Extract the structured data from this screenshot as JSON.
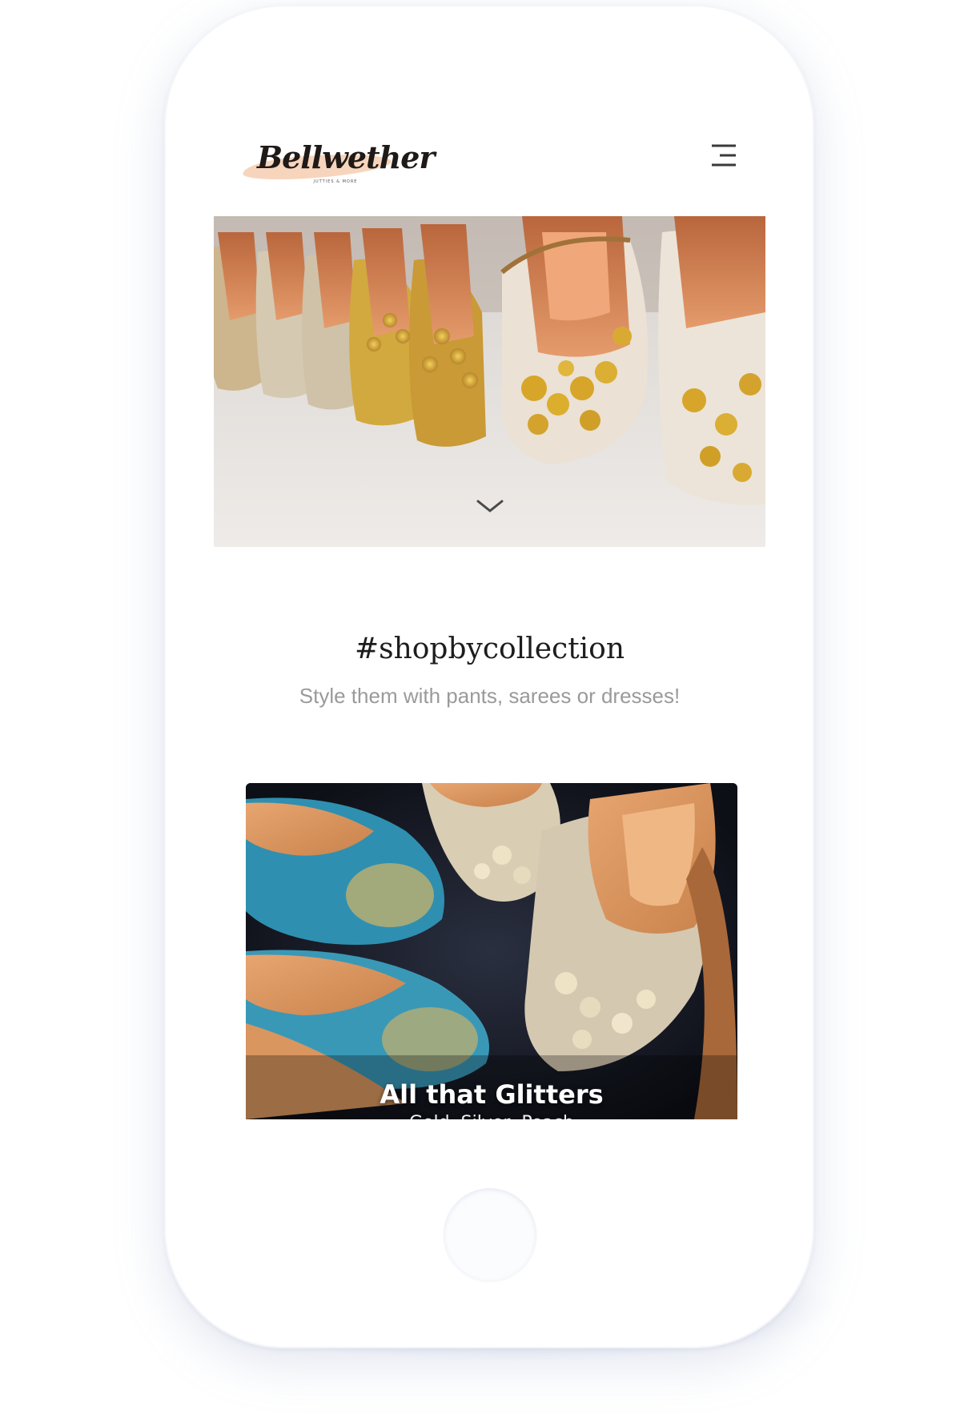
{
  "header": {
    "logo_text": "Bellwether",
    "logo_tagline": "JUTTIES & MORE"
  },
  "icons": {
    "menu": "hamburger-menu-icon",
    "scroll": "chevron-down-icon"
  },
  "section": {
    "title": "#shopbycollection",
    "subtitle": "Style them with pants, sarees or dresses!"
  },
  "collection_card": {
    "title": "All that Glitters",
    "subtitle": "Gold, Silver, Peach"
  },
  "colors": {
    "logo_swash": "#f7d5bd",
    "title_text": "#1d1d1d",
    "subtitle_text": "#9a9a9a",
    "card_background": "#12141c"
  }
}
